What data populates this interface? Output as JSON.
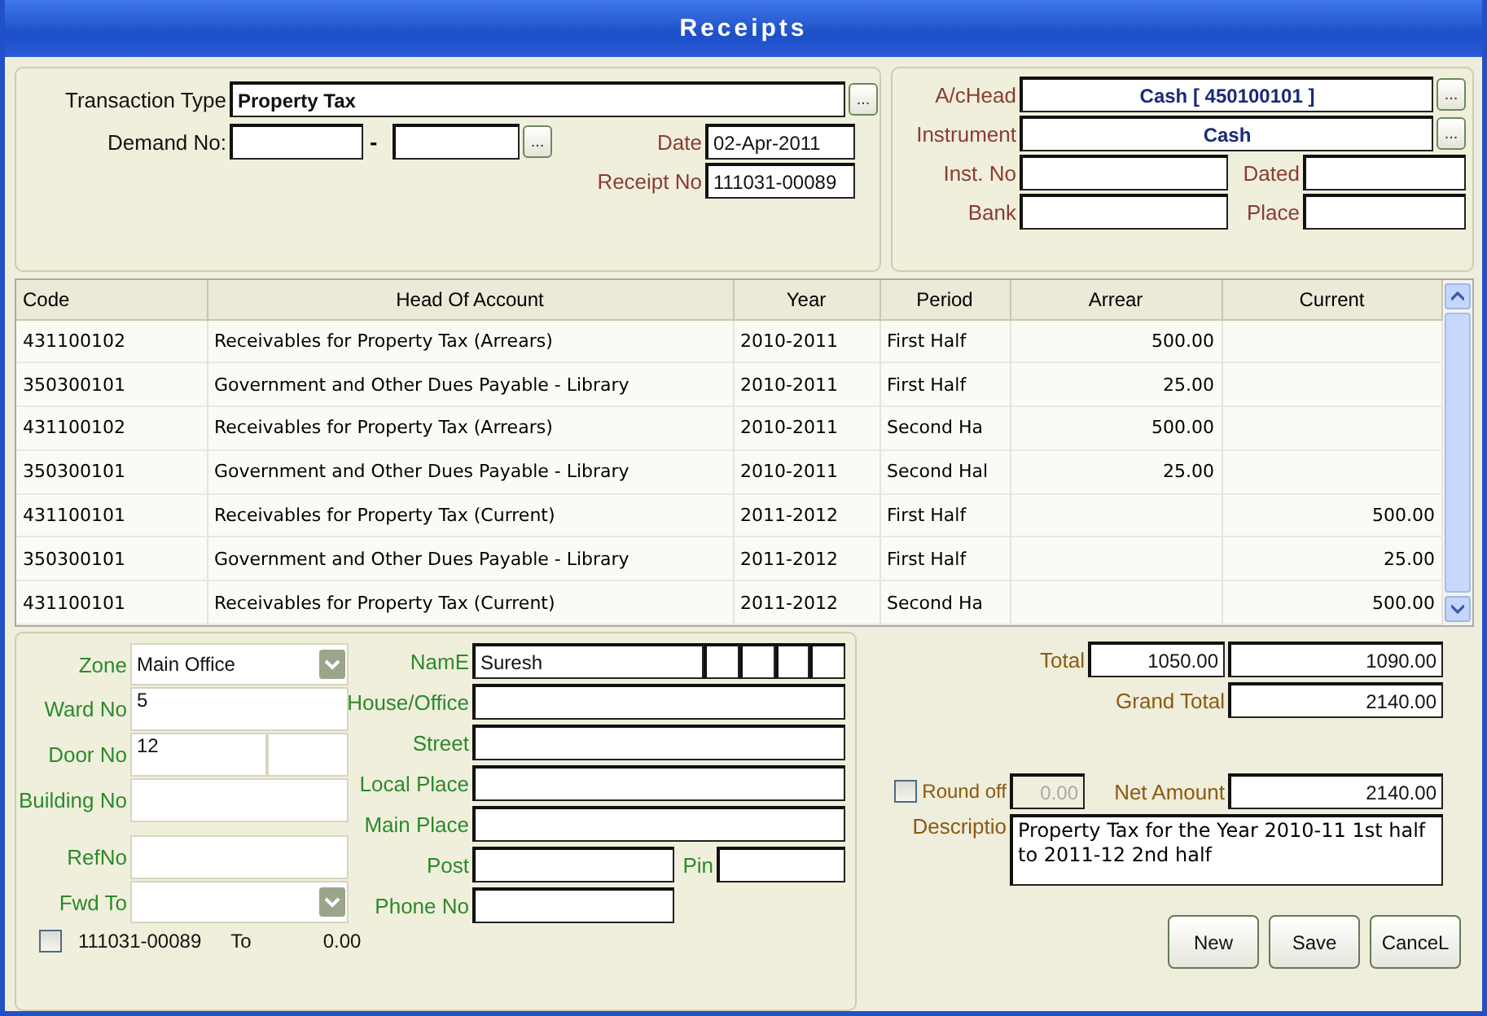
{
  "window": {
    "title": "Receipts"
  },
  "transaction": {
    "type_label": "Transaction Type",
    "type_value": "Property Tax",
    "type_button": "...",
    "demand_label": "Demand No:",
    "demand_separator": "-",
    "demand_button": "...",
    "date_label": "Date",
    "date_value": "02-Apr-2011",
    "receipt_label": "Receipt No",
    "receipt_value": "111031-00089"
  },
  "account": {
    "head_label": "A/cHead",
    "head_value": "Cash [ 450100101 ]",
    "head_button": "...",
    "instrument_label": "Instrument",
    "instrument_value": "Cash",
    "instrument_button": "...",
    "inst_no_label": "Inst. No",
    "dated_label": "Dated",
    "bank_label": "Bank",
    "place_label": "Place"
  },
  "table": {
    "columns": [
      "Code",
      "Head Of Account",
      "Year",
      "Period",
      "Arrear",
      "Current"
    ],
    "rows": [
      {
        "code": "431100102",
        "head": "Receivables for Property Tax (Arrears)",
        "year": "2010-2011",
        "period": "First Half",
        "arrear": "500.00",
        "current": ""
      },
      {
        "code": "350300101",
        "head": "Government and Other Dues Payable - Library",
        "year": "2010-2011",
        "period": "First Half",
        "arrear": "25.00",
        "current": ""
      },
      {
        "code": "431100102",
        "head": "Receivables for Property Tax (Arrears)",
        "year": "2010-2011",
        "period": "Second Ha",
        "arrear": "500.00",
        "current": ""
      },
      {
        "code": "350300101",
        "head": "Government and Other Dues Payable - Library",
        "year": "2010-2011",
        "period": "Second Hal",
        "arrear": "25.00",
        "current": ""
      },
      {
        "code": "431100101",
        "head": "Receivables for Property Tax (Current)",
        "year": "2011-2012",
        "period": "First Half",
        "arrear": "",
        "current": "500.00"
      },
      {
        "code": "350300101",
        "head": "Government and Other Dues Payable - Library",
        "year": "2011-2012",
        "period": "First Half",
        "arrear": "",
        "current": "25.00"
      },
      {
        "code": "431100101",
        "head": "Receivables for Property Tax (Current)",
        "year": "2011-2012",
        "period": "Second Ha",
        "arrear": "",
        "current": "500.00"
      }
    ]
  },
  "address": {
    "zone_label": "Zone",
    "zone_value": "Main Office",
    "ward_label": "Ward No",
    "ward_value": "5",
    "door_label": "Door No",
    "door_value": "12",
    "building_label": "Building No",
    "ref_label": "RefNo",
    "fwd_label": "Fwd To",
    "name_label": "NamE",
    "name_value": "Suresh",
    "house_label": "House/Office",
    "street_label": "Street",
    "local_label": "Local Place",
    "main_label": "Main Place",
    "post_label": "Post",
    "pin_label": "Pin",
    "phone_label": "Phone No"
  },
  "footer": {
    "checked": false,
    "receipt": "111031-00089",
    "to": "To",
    "amount": "0.00"
  },
  "totals": {
    "total_label": "Total",
    "total_arrear": "1050.00",
    "total_current": "1090.00",
    "grand_label": "Grand Total",
    "grand_value": "2140.00",
    "round_off_label": "Round off",
    "round_off_checked": false,
    "round_off_value": "0.00",
    "round_off_disabled": true,
    "net_label": "Net Amount",
    "net_value": "2140.00",
    "description_label": "Descriptio",
    "description": "Property Tax for the Year 2010-11 1st half to 2011-12 2nd half"
  },
  "buttons": [
    "New",
    "Save",
    "CanceL"
  ]
}
